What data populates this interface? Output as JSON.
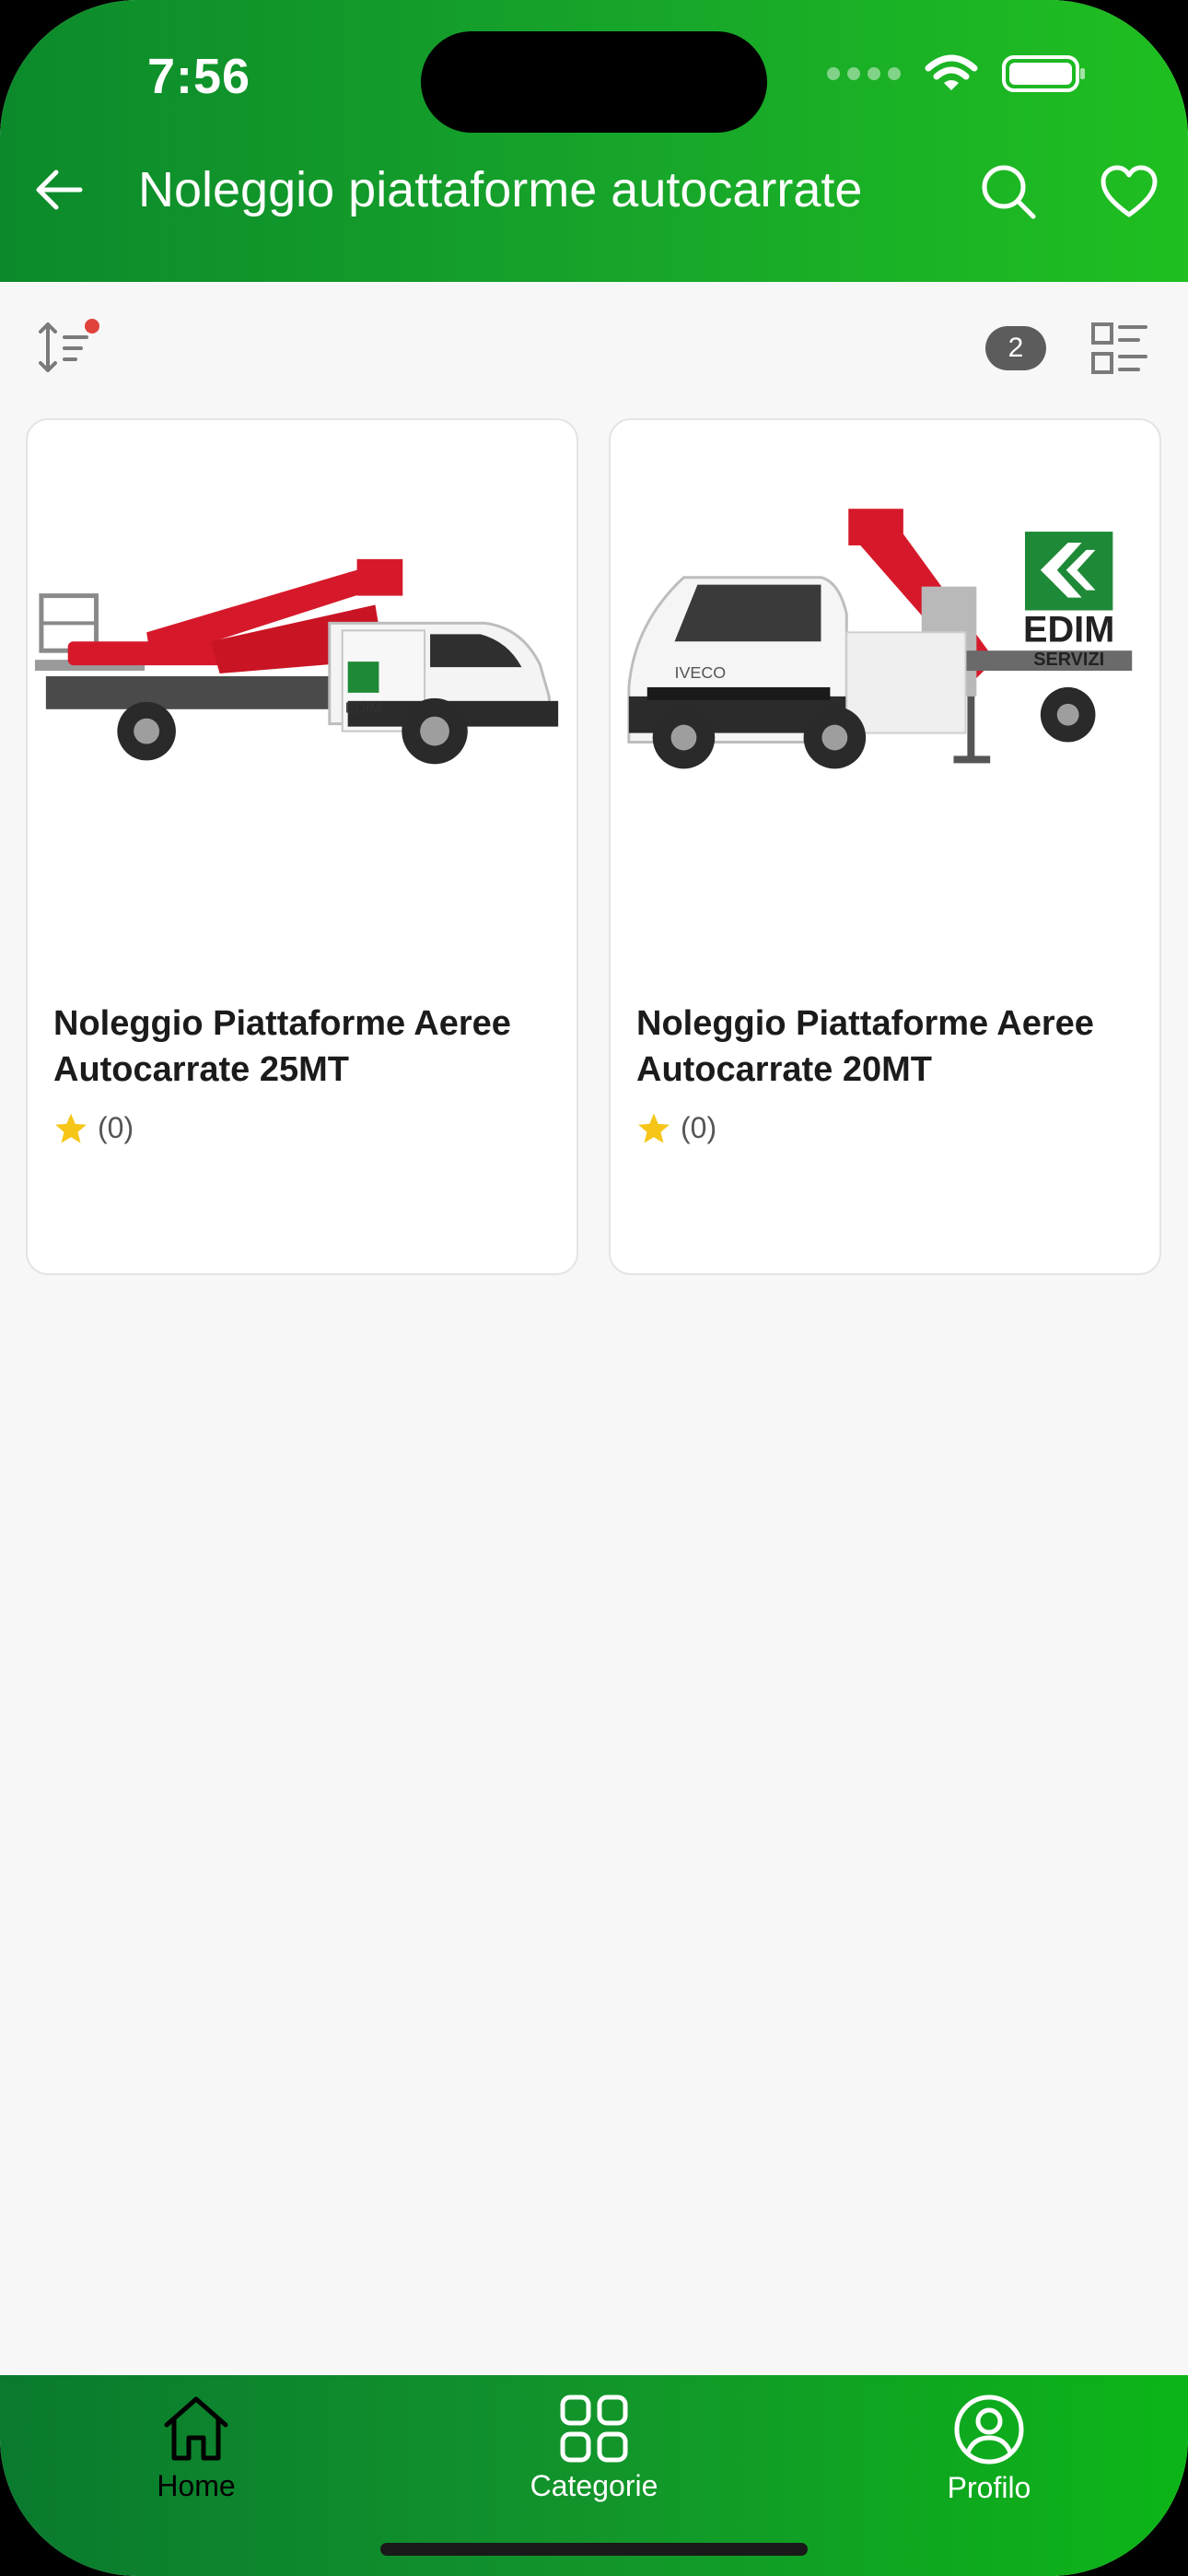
{
  "status_bar": {
    "time": "7:56"
  },
  "app_bar": {
    "title": "Noleggio piattaforme autocarrate",
    "back_icon": "arrow-left-icon",
    "search_icon": "search-icon",
    "favorite_icon": "heart-icon"
  },
  "toolbar": {
    "sort_icon": "sort-icon",
    "result_count": "2",
    "view_toggle_icon": "list-view-icon"
  },
  "products": [
    {
      "title": "Noleggio Piattaforme Aeree Autocarrate 25MT",
      "rating_count": "(0)",
      "image_icon": "truck-platform-image"
    },
    {
      "title": "Noleggio Piattaforme Aeree Autocarrate 20MT",
      "rating_count": "(0)",
      "image_icon": "truck-platform-image"
    }
  ],
  "bottom_nav": {
    "items": [
      {
        "label": "Home",
        "icon": "home-icon"
      },
      {
        "label": "Categorie",
        "icon": "grid-icon"
      },
      {
        "label": "Profilo",
        "icon": "profile-icon"
      }
    ]
  },
  "colors": {
    "brand_green": "#17a62a",
    "star": "#f5c518",
    "badge": "#5c5c5c"
  }
}
